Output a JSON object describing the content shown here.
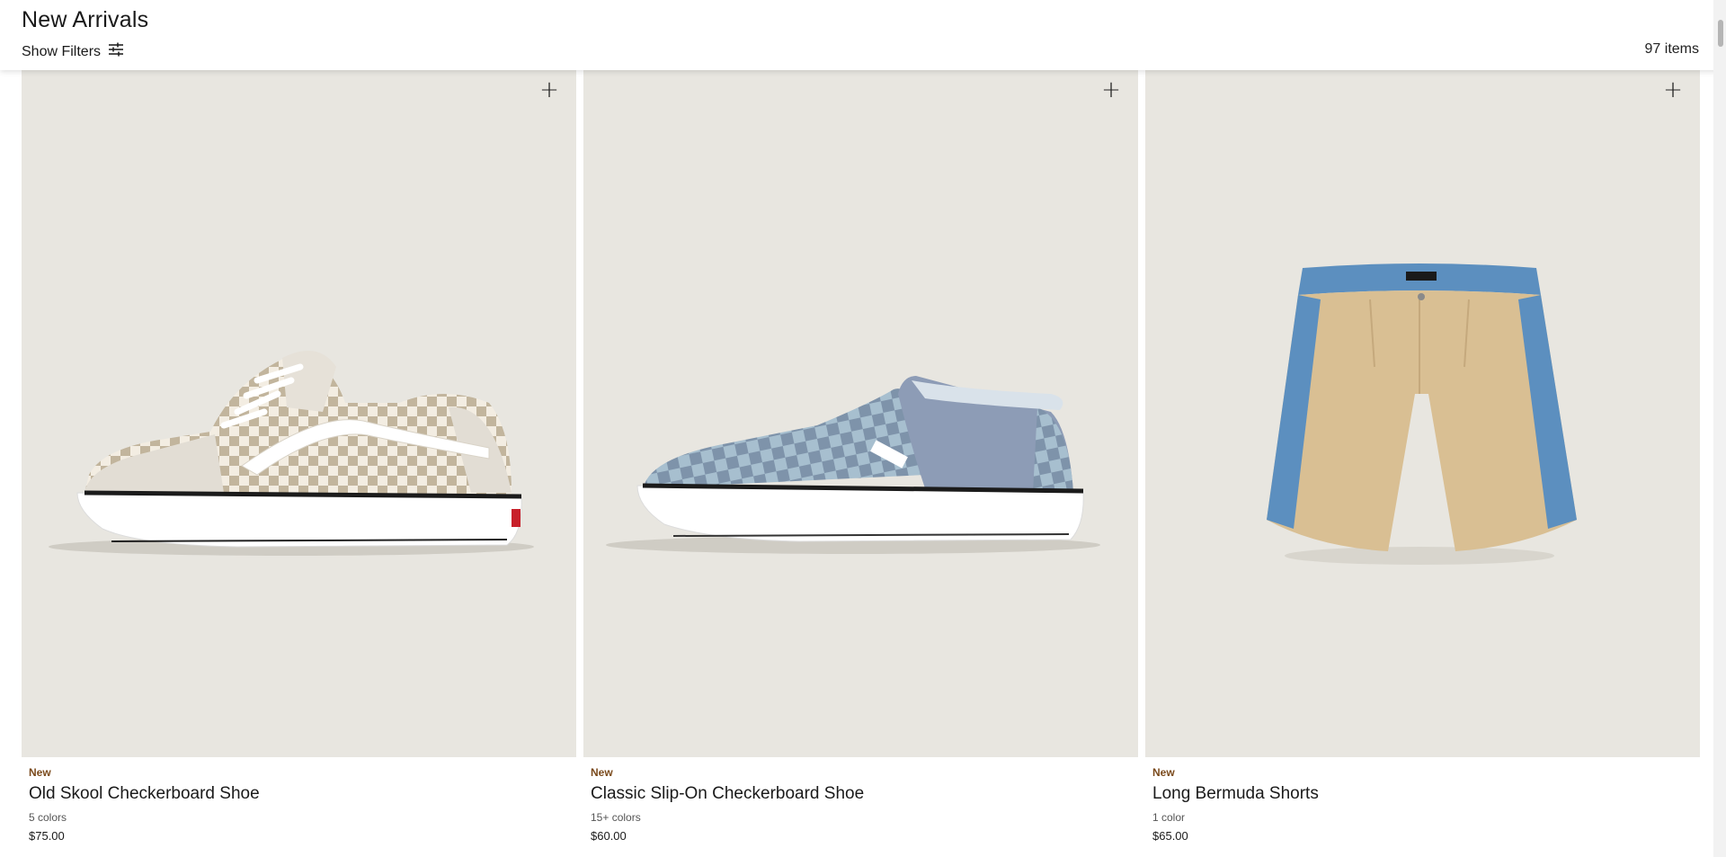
{
  "header": {
    "title": "New Arrivals",
    "filters_label": "Show Filters",
    "filters_icon": "sliders-icon",
    "item_count": "97 items"
  },
  "products": [
    {
      "badge": "New",
      "name": "Old Skool Checkerboard Shoe",
      "colors": "5 colors",
      "price": "$75.00",
      "add_icon": "plus-icon",
      "image": "beige-checkerboard-sneaker"
    },
    {
      "badge": "New",
      "name": "Classic Slip-On Checkerboard Shoe",
      "colors": "15+ colors",
      "price": "$60.00",
      "add_icon": "plus-icon",
      "image": "blue-checkerboard-slip-on"
    },
    {
      "badge": "New",
      "name": "Long Bermuda Shorts",
      "colors": "1 color",
      "price": "$65.00",
      "add_icon": "plus-icon",
      "image": "khaki-denim-bermuda-shorts"
    }
  ],
  "colors": {
    "image_background": "#e8e6e0",
    "badge": "#7a4a1c"
  }
}
